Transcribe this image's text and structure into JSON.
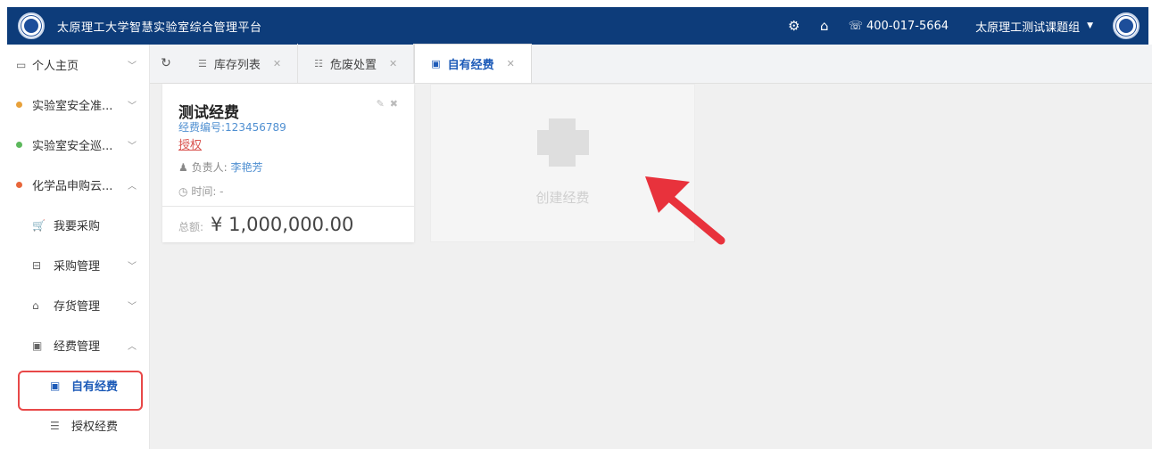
{
  "header": {
    "title": "太原理工大学智慧实验室综合管理平台",
    "phone": "400-017-5664",
    "user_group": "太原理工测试课题组"
  },
  "sidebar": {
    "items": [
      {
        "label": "个人主页"
      },
      {
        "label": "实验室安全准...",
        "dot_color": "#e8a13a"
      },
      {
        "label": "实验室安全巡...",
        "dot_color": "#5cb85c"
      },
      {
        "label": "化学品申购云...",
        "dot_color": "#e8663a"
      },
      {
        "label": "我要采购"
      },
      {
        "label": "采购管理"
      },
      {
        "label": "存货管理"
      },
      {
        "label": "经费管理"
      },
      {
        "label": "自有经费"
      },
      {
        "label": "授权经费"
      }
    ]
  },
  "tabs": [
    {
      "label": "库存列表"
    },
    {
      "label": "危废处置"
    },
    {
      "label": "自有经费"
    }
  ],
  "fund_card": {
    "title": "测试经费",
    "code": "经费编号:123456789",
    "auth_link": "授权",
    "owner_label": "负责人:",
    "owner_name": "李艳芳",
    "time": "时间: -",
    "total_label": "总额:",
    "total_amount": "¥ 1,000,000.00"
  },
  "create_card": {
    "label": "创建经费"
  },
  "colors": {
    "topbar": "#0d3c7a",
    "accent": "#1d5bb8",
    "highlight": "#e84848",
    "arrow": "#e8323c"
  }
}
